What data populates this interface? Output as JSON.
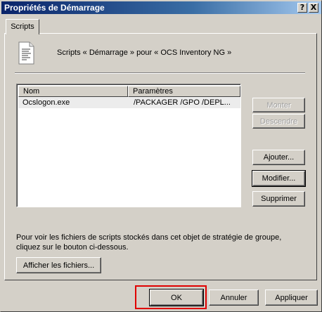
{
  "window": {
    "title": "Propriétés de Démarrage",
    "help_glyph": "?",
    "close_glyph": "X"
  },
  "tabs": [
    {
      "label": "Scripts",
      "active": true
    }
  ],
  "header": {
    "icon": "script-file-icon",
    "text": "Scripts « Démarrage » pour « OCS Inventory NG »"
  },
  "list": {
    "columns": [
      "Nom",
      "Paramètres"
    ],
    "rows": [
      {
        "name": "Ocslogon.exe",
        "params": "/PACKAGER /GPO /DEPL..."
      }
    ]
  },
  "side_buttons": {
    "monter": "Monter",
    "descendre": "Descendre",
    "ajouter": "Ajouter...",
    "modifier": "Modifier...",
    "supprimer": "Supprimer"
  },
  "info": {
    "text": "Pour voir les fichiers de scripts stockés dans cet objet de stratégie de groupe, cliquez sur le bouton ci-dessous.",
    "show_files_button": "Afficher les fichiers..."
  },
  "footer": {
    "ok": "OK",
    "cancel": "Annuler",
    "apply": "Appliquer"
  },
  "colors": {
    "face": "#d4d0c8",
    "titlebar_start": "#0a246a",
    "highlight_box": "#e00000"
  }
}
